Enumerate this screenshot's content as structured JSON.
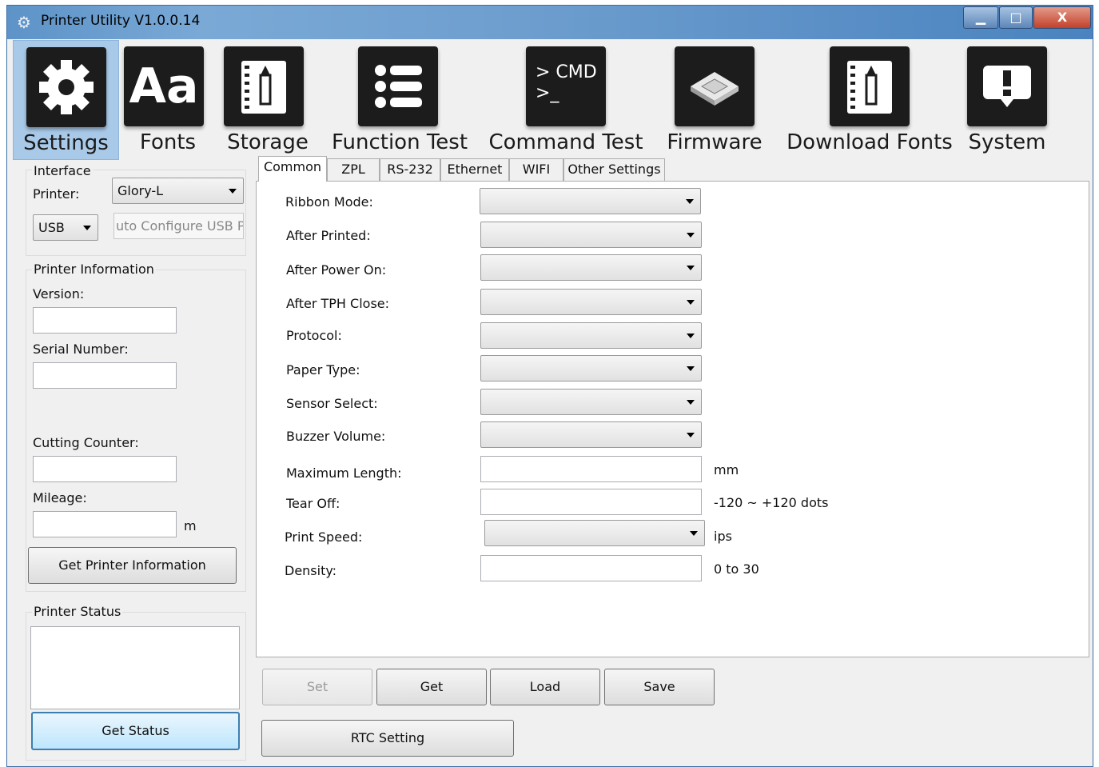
{
  "window": {
    "title": "Printer Utility  V1.0.0.14",
    "minimize_label": "▁",
    "maximize_label": "□",
    "close_label": "X"
  },
  "toolbar": {
    "items": [
      {
        "label": "Settings",
        "icon": "gear-icon",
        "selected": true
      },
      {
        "label": "Fonts",
        "icon": "font-icon",
        "glyph": "Aa"
      },
      {
        "label": "Storage",
        "icon": "notebook-icon"
      },
      {
        "label": "Function Test",
        "icon": "list-icon"
      },
      {
        "label": "Command Test",
        "icon": "cmd-icon",
        "glyph_line1": "> CMD",
        "glyph_line2": ">_"
      },
      {
        "label": "Firmware",
        "icon": "chip-icon"
      },
      {
        "label": "Download Fonts",
        "icon": "notebook-icon"
      },
      {
        "label": "System",
        "icon": "alert-icon"
      }
    ]
  },
  "left": {
    "interface_title": "Interface",
    "printer_label": "Printer:",
    "printer_value": "Glory-L",
    "port_value": "USB",
    "port_config": "uto Configure USB Po",
    "info_title": "Printer Information",
    "version_label": "Version:",
    "serial_label": "Serial Number:",
    "cutting_label": "Cutting Counter:",
    "mileage_label": "Mileage:",
    "mileage_unit": "m",
    "get_info_button": "Get Printer Information",
    "status_title": "Printer Status",
    "get_status_button": "Get Status"
  },
  "tabs": [
    "Common",
    "ZPL",
    "RS-232",
    "Ethernet",
    "WIFI",
    "Other Settings"
  ],
  "form": {
    "ribbon_mode": "Ribbon Mode:",
    "after_printed": "After Printed:",
    "after_power_on": "After Power On:",
    "after_tph_close": "After TPH Close:",
    "protocol": "Protocol:",
    "paper_type": "Paper Type:",
    "sensor_select": "Sensor Select:",
    "buzzer_volume": "Buzzer Volume:",
    "maximum_length": "Maximum Length:",
    "maximum_length_unit": "mm",
    "tear_off": "Tear Off:",
    "tear_off_unit": "-120 ~ +120 dots",
    "print_speed": "Print Speed:",
    "print_speed_unit": "ips",
    "density": "Density:",
    "density_unit": "0 to 30"
  },
  "actions": {
    "set": "Set",
    "get": "Get",
    "load": "Load",
    "save": "Save",
    "rtc": "RTC Setting"
  }
}
